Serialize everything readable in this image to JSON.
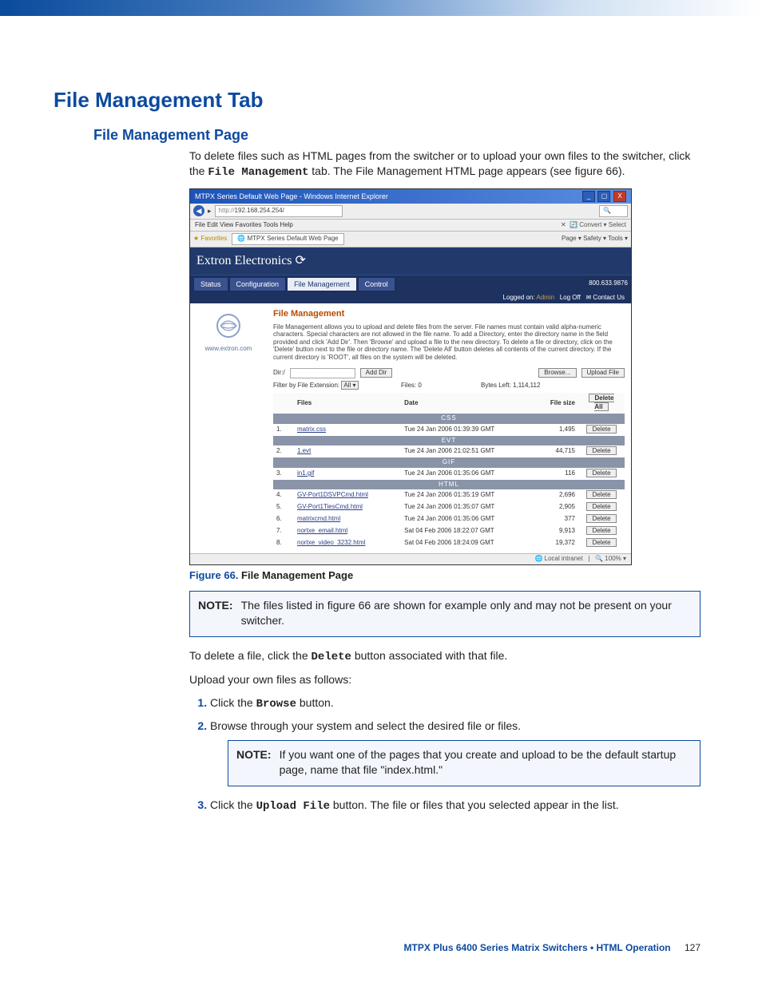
{
  "headings": {
    "h1": "File Management Tab",
    "h2": "File Management Page"
  },
  "intro": {
    "p1a": "To delete files such as HTML pages from the switcher or to upload your own files to the switcher, click the ",
    "p1b": "File Management",
    "p1c": " tab. The File Management HTML page appears (see figure 66)."
  },
  "figure": {
    "label": "Figure 66.",
    "title": "File Management Page"
  },
  "note1": {
    "label": "NOTE:",
    "text": "The files listed in figure 66 are shown for example only and may not be present on your switcher."
  },
  "body2": {
    "p1a": "To delete a file, click the ",
    "p1b": "Delete",
    "p1c": " button associated with that file.",
    "p2": "Upload your own files as follows:"
  },
  "steps": {
    "s1a": "Click the ",
    "s1b": "Browse",
    "s1c": " button.",
    "s2": "Browse through your system and select the desired file or files.",
    "s3a": "Click the ",
    "s3b": "Upload File",
    "s3c": " button. The file or files that you selected appear in the list."
  },
  "note2": {
    "label": "NOTE:",
    "text": "If you want one of the pages that you create and upload to be the default startup page, name that file \"index.html.\""
  },
  "footer": {
    "book": "MTPX Plus 6400 Series Matrix Switchers • HTML Operation",
    "page": "127"
  },
  "shot": {
    "window_title": "MTPX Series Default Web Page - Windows Internet Explorer",
    "url": "192.168.254.254/",
    "menus": "File   Edit   View   Favorites   Tools   Help",
    "convert": "Convert  ▾   Select",
    "favorites": "Favorites",
    "tab_name": "MTPX Series Default Web Page",
    "tools_right": "Page ▾  Safety ▾  Tools ▾",
    "banner": "Extron Electronics ⟳",
    "tabs": {
      "status": "Status",
      "config": "Configuration",
      "fm": "File Management",
      "control": "Control"
    },
    "phone": "800.633.9876",
    "login": {
      "label": "Logged on:",
      "user": "Admin",
      "logoff": "Log Off",
      "contact": "Contact Us"
    },
    "side_link": "www.extron.com",
    "fm_title": "File Management",
    "fm_desc": "File Management allows you to upload and delete files from the server. File names must contain valid alpha-numeric characters. Special characters are not allowed in the file name. To add a Directory, enter the directory name in the field provided and click 'Add Dir'. Then 'Browse' and upload a file to the new directory. To delete a file or directory, click on the 'Delete' button next to the file or directory name. The 'Delete All' button deletes all contents of the current directory. If the current directory is 'ROOT', all files on the system will be deleted.",
    "dir_label": "Dir:/",
    "add_dir": "Add Dir",
    "browse": "Browse...",
    "upload": "Upload File",
    "filter_label": "Filter by File Extension:",
    "filter_all": "All ▾",
    "files_label": "Files:",
    "files_count": "0",
    "bytes_label": "Bytes Left:",
    "bytes_val": "1,114,112",
    "cols": {
      "files": "Files",
      "date": "Date",
      "size": "File size"
    },
    "delete_all": "Delete All",
    "delete": "Delete",
    "groups": {
      "css": "CSS",
      "evt": "EVT",
      "gif": "GIF",
      "html": "HTML"
    },
    "rows": [
      {
        "n": "1.",
        "name": "matrix.css",
        "date": "Tue 24 Jan 2006 01:39:39 GMT",
        "size": "1,495"
      },
      {
        "n": "2.",
        "name": "1.evt",
        "date": "Tue 24 Jan 2006 21:02:51 GMT",
        "size": "44,715"
      },
      {
        "n": "3.",
        "name": "in1.gif",
        "date": "Tue 24 Jan 2006 01:35:06 GMT",
        "size": "116"
      },
      {
        "n": "4.",
        "name": "GV-Port1DSVPCmd.html",
        "date": "Tue 24 Jan 2006 01:35:19 GMT",
        "size": "2,696"
      },
      {
        "n": "5.",
        "name": "GV-Port1TiesCmd.html",
        "date": "Tue 24 Jan 2006 01:35:07 GMT",
        "size": "2,905"
      },
      {
        "n": "6.",
        "name": "matrixcmd.html",
        "date": "Tue 24 Jan 2006 01:35:06 GMT",
        "size": "377"
      },
      {
        "n": "7.",
        "name": "nortxe_email.html",
        "date": "Sat 04 Feb 2006 18:22:07 GMT",
        "size": "9,913"
      },
      {
        "n": "8.",
        "name": "nortxe_video_3232.html",
        "date": "Sat 04 Feb 2006 18:24:09 GMT",
        "size": "19,372"
      }
    ],
    "status_left": "Local intranet",
    "status_right": "100%  ▾"
  }
}
